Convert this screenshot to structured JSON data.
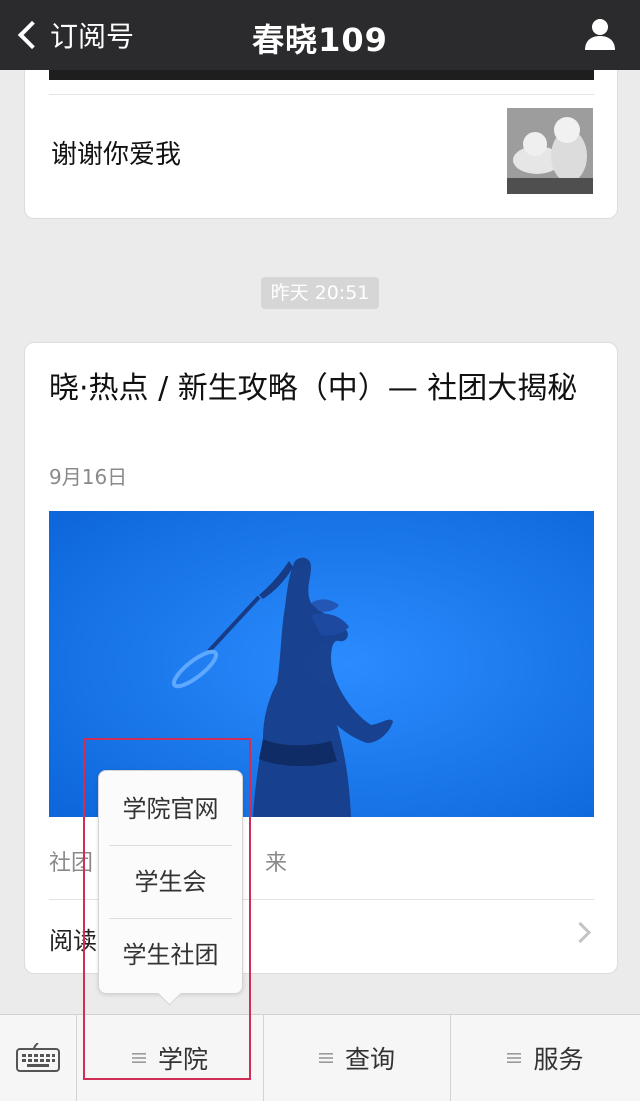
{
  "header": {
    "back_label": "订阅号",
    "title": "春晓109",
    "back_icon": "chevron-left-icon",
    "profile_icon": "person-icon"
  },
  "previous_item": {
    "title": "谢谢你爱我"
  },
  "timestamp": "昨天 20:51",
  "article": {
    "title": "晓·热点 / 新生攻略（中）— 社团大揭秘",
    "date": "9月16日",
    "summary_visible_start": "社团",
    "summary_visible_end": "来",
    "read_label": "阅读"
  },
  "popup_menu": {
    "items": [
      "学院官网",
      "学生会",
      "学生社团"
    ]
  },
  "bottom_menu": {
    "keyboard_icon": "keyboard-icon",
    "tabs": [
      {
        "label": "学院",
        "icon": "menu-lines-icon"
      },
      {
        "label": "查询",
        "icon": "menu-lines-icon"
      },
      {
        "label": "服务",
        "icon": "menu-lines-icon"
      }
    ]
  },
  "colors": {
    "header_bg": "#2b2b2d",
    "highlight_border": "#cf2e55",
    "page_bg": "#ebebeb",
    "cover_blue": "#1777e8"
  }
}
